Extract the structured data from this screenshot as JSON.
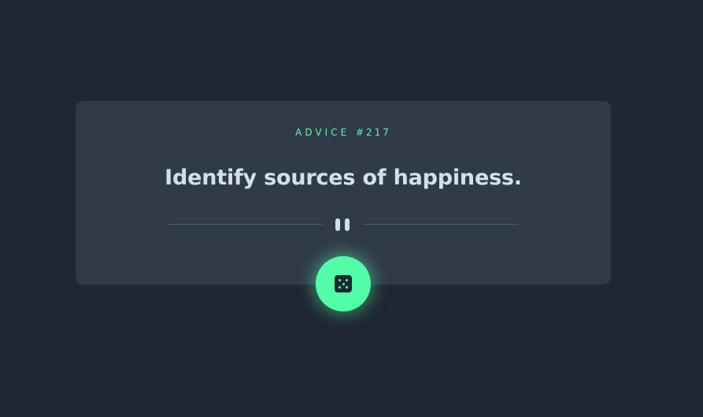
{
  "advice": {
    "label": "ADVICE",
    "number": "#217",
    "text": "Identify sources of happiness."
  },
  "icons": {
    "divider": "pause-icon",
    "button": "dice-icon"
  },
  "colors": {
    "background": "#202632",
    "card": "#313a48",
    "accent": "#52ffa8",
    "text": "#cee3e9",
    "divider": "#4f5d74"
  }
}
